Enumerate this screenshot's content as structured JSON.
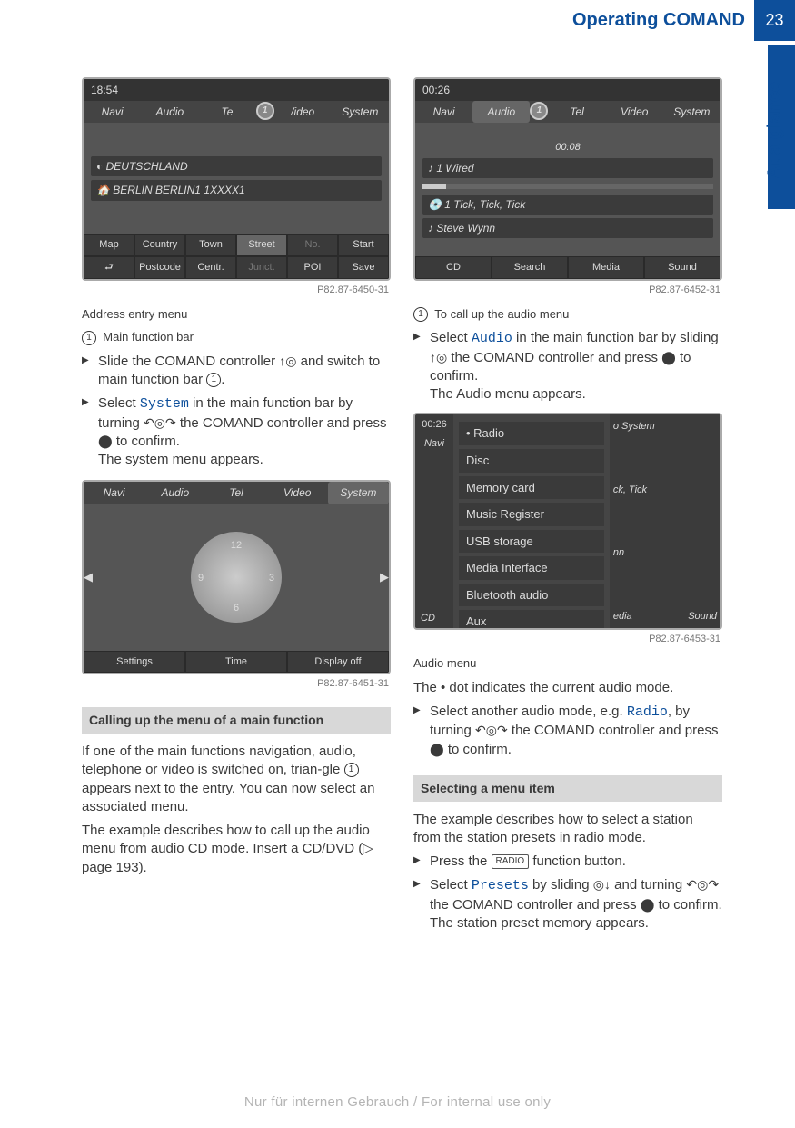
{
  "header": {
    "title": "Operating COMAND",
    "page": "23"
  },
  "side": {
    "label": "At a glance"
  },
  "left": {
    "fig1": {
      "time": "18:54",
      "tabs": [
        "Navi",
        "Audio",
        "Te",
        "/ideo",
        "System"
      ],
      "pin": "1",
      "line1": "DEUTSCHLAND",
      "line2": "BERLIN BERLIN1 1XXXX1",
      "bottom1": [
        "Map",
        "Country",
        "Town",
        "Street",
        "No.",
        "Start"
      ],
      "bottom2": [
        "⮐",
        "Postcode",
        "Centr.",
        "Junct.",
        "POI",
        "Save"
      ],
      "id": "P82.87-6450-31"
    },
    "caption1": "Address entry menu",
    "label1": "Main function bar",
    "step1a": "Slide the COMAND controller ",
    "step1b": " and switch to main function bar ",
    "step2a": "Select ",
    "step2code": "System",
    "step2b": " in the main function bar by turning ",
    "step2c": " the COMAND controller and press ",
    "step2d": " to confirm.",
    "step2e": "The system menu appears.",
    "fig2": {
      "tabs": [
        "Navi",
        "Audio",
        "Tel",
        "Video",
        "System"
      ],
      "bottom": [
        "Settings",
        "Time",
        "Display off"
      ],
      "id": "P82.87-6451-31"
    },
    "sect": "Calling up the menu of a main function",
    "p1a": "If one of the main functions navigation, audio, telephone or video is switched on, trian-gle ",
    "p1b": " appears next to the entry. You can now select an associated menu.",
    "p2": "The example describes how to call up the audio menu from audio CD mode. Insert a CD/DVD (▷ page 193)."
  },
  "right": {
    "fig3": {
      "time": "00:26",
      "tabs": [
        "Navi",
        "Audio",
        "Tel",
        "Video",
        "System"
      ],
      "pin": "1",
      "track_time": "00:08",
      "line1": "1 Wired",
      "line2": "1 Tick, Tick, Tick",
      "line3": "Steve Wynn",
      "bottom": [
        "CD",
        "Search",
        "Media",
        "Sound"
      ],
      "id": "P82.87-6452-31"
    },
    "label1": "To call up the audio menu",
    "step1a": "Select ",
    "step1code": "Audio",
    "step1b": " in the main function bar by sliding ",
    "step1c": " the COMAND controller and press ",
    "step1d": " to confirm.",
    "step1e": "The Audio menu appears.",
    "fig4": {
      "time": "00:26",
      "list": [
        "Radio",
        "Disc",
        "Memory card",
        "Music Register",
        "USB storage",
        "Media Interface",
        "Bluetooth audio",
        "Aux"
      ],
      "side_hints": [
        "o   System",
        "",
        "",
        "",
        "ck, Tick",
        "nn",
        ""
      ],
      "bottom": [
        "CD",
        "",
        "edia",
        "Sound"
      ],
      "id": "P82.87-6453-31"
    },
    "caption4": "Audio menu",
    "p3": "The   •  dot indicates the current audio mode.",
    "step3a": "Select another audio mode, e.g. ",
    "step3code": "Radio",
    "step3b": ", by turning ",
    "step3c": " the COMAND controller and press ",
    "step3d": " to confirm.",
    "sect2": "Selecting a menu item",
    "p4": "The example describes how to select a station from the station presets in radio mode.",
    "step4a": "Press the ",
    "step4btn": "RADIO",
    "step4b": " function button.",
    "step5a": "Select ",
    "step5code": "Presets",
    "step5b": " by sliding ",
    "step5c": " and turning ",
    "step5d": " the COMAND controller and press ",
    "step5e": " to confirm.",
    "step5f": "The station preset memory appears."
  },
  "footer": "Nur für internen Gebrauch / For internal use only"
}
